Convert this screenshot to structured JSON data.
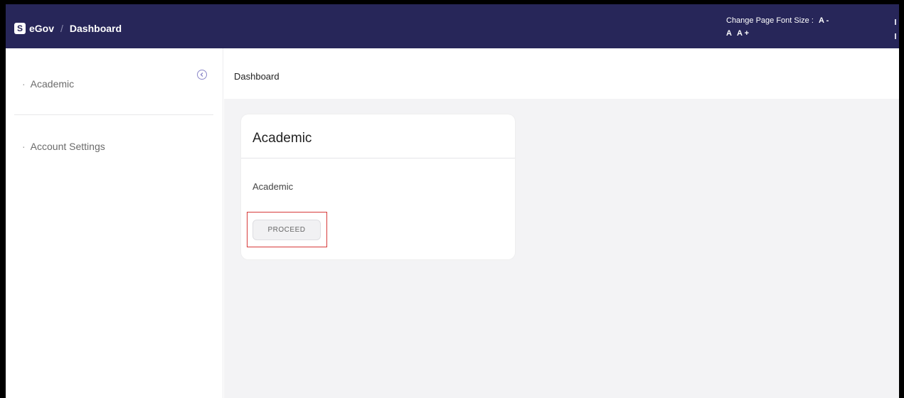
{
  "header": {
    "logo_letter": "S",
    "app_name": "eGov",
    "separator": "/",
    "page_name": "Dashboard",
    "font_size_label": "Change Page Font Size :",
    "font_decrease": "A -",
    "font_default": "A",
    "font_increase": "A +"
  },
  "sidebar": {
    "items": [
      {
        "label": "Academic"
      },
      {
        "label": "Account Settings"
      }
    ]
  },
  "main": {
    "breadcrumb_title": "Dashboard",
    "card": {
      "title": "Academic",
      "description": "Academic",
      "button_label": "PROCEED"
    }
  },
  "colors": {
    "header_bg": "#272659",
    "main_bg": "#f3f3f5",
    "highlight": "#d63a3a"
  }
}
